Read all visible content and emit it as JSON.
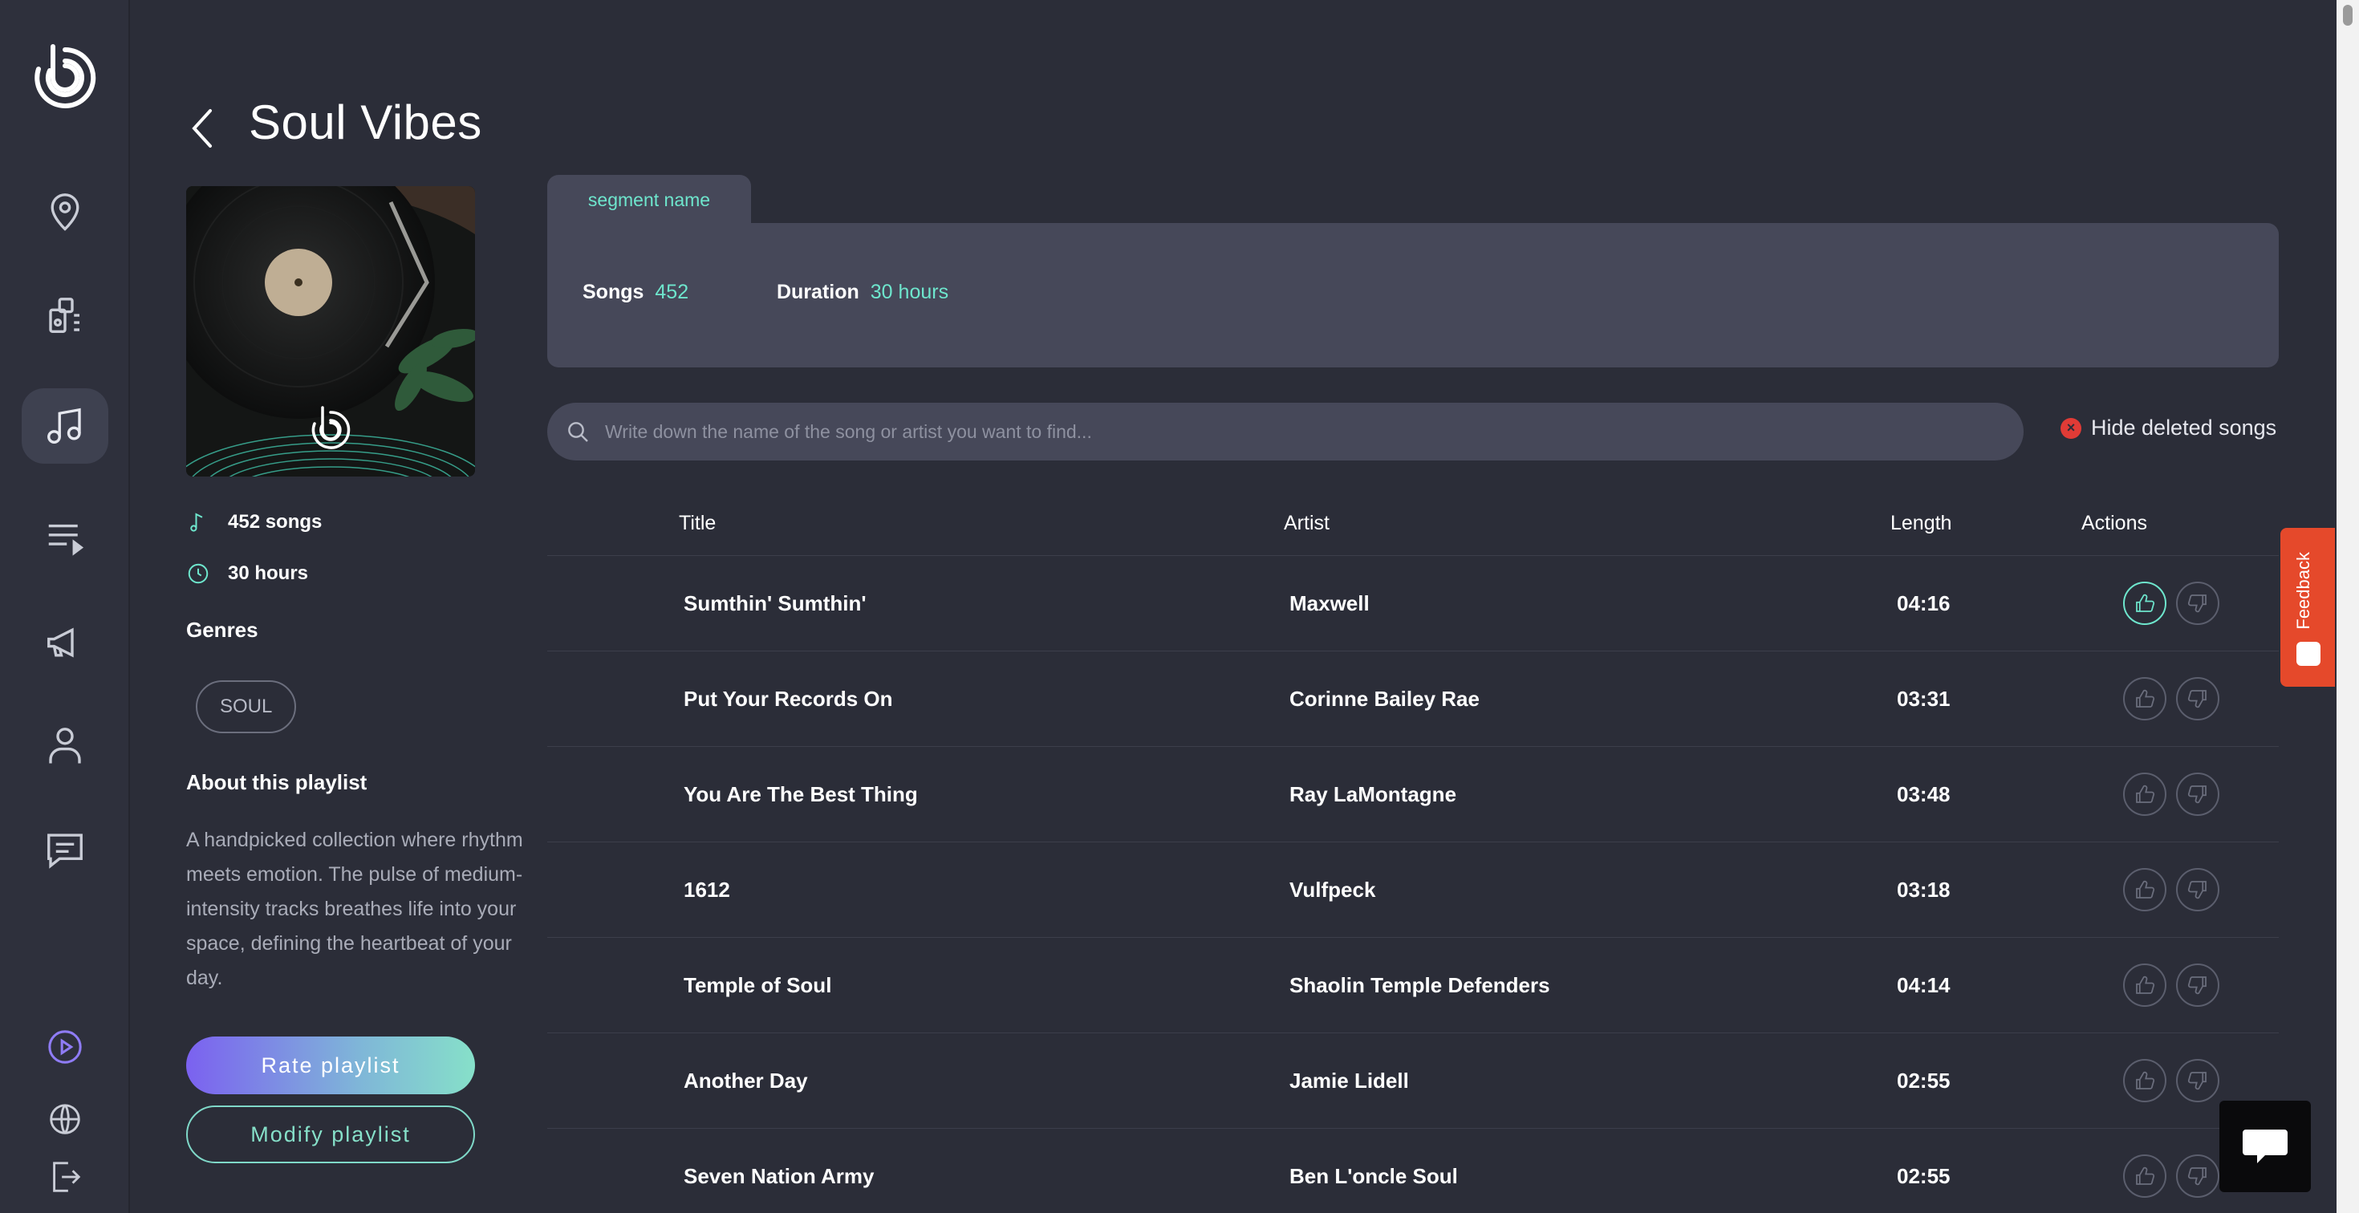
{
  "page": {
    "title": "Soul Vibes"
  },
  "playlist": {
    "songs_meta": "452 songs",
    "hours_meta": "30 hours",
    "genres_label": "Genres",
    "genres": [
      "SOUL"
    ],
    "about_label": "About this playlist",
    "about_text": "A handpicked collection where rhythm meets emotion. The pulse of medium-intensity tracks breathes life into your space, defining the heartbeat of your day.",
    "rate_button": "Rate playlist",
    "modify_button": "Modify playlist"
  },
  "segment": {
    "tab_label": "segment name",
    "songs_label": "Songs",
    "songs_value": "452",
    "duration_label": "Duration",
    "duration_value": "30 hours"
  },
  "search": {
    "placeholder": "Write down the name of the song or artist you want to find...",
    "hide_deleted_label": "Hide deleted songs"
  },
  "table": {
    "headers": {
      "title": "Title",
      "artist": "Artist",
      "length": "Length",
      "actions": "Actions"
    },
    "rows": [
      {
        "title": "Sumthin' Sumthin'",
        "artist": "Maxwell",
        "length": "04:16",
        "liked": true
      },
      {
        "title": "Put Your Records On",
        "artist": "Corinne Bailey Rae",
        "length": "03:31",
        "liked": false
      },
      {
        "title": "You Are The Best Thing",
        "artist": "Ray LaMontagne",
        "length": "03:48",
        "liked": false
      },
      {
        "title": "1612",
        "artist": "Vulfpeck",
        "length": "03:18",
        "liked": false
      },
      {
        "title": "Temple of Soul",
        "artist": "Shaolin Temple Defenders",
        "length": "04:14",
        "liked": false
      },
      {
        "title": "Another Day",
        "artist": "Jamie Lidell",
        "length": "02:55",
        "liked": false
      },
      {
        "title": "Seven Nation Army",
        "artist": "Ben L'oncle Soul",
        "length": "02:55",
        "liked": false
      }
    ]
  },
  "feedback": {
    "label": "Feedback"
  },
  "colors": {
    "accent": "#6ee6cd",
    "background": "#2b2d38",
    "card": "#464859",
    "gradient_start": "#7b61f0",
    "gradient_end": "#86e0c9",
    "feedback": "#e5492b"
  },
  "icons": {
    "sidebar": [
      "location-pin-icon",
      "devices-icon",
      "music-note-icon",
      "queue-icon",
      "megaphone-icon",
      "user-icon",
      "message-icon"
    ],
    "sidebar_bottom": [
      "play-circle-icon",
      "globe-icon",
      "logout-icon"
    ],
    "actions": [
      "thumbs-up-icon",
      "thumbs-down-icon"
    ]
  }
}
